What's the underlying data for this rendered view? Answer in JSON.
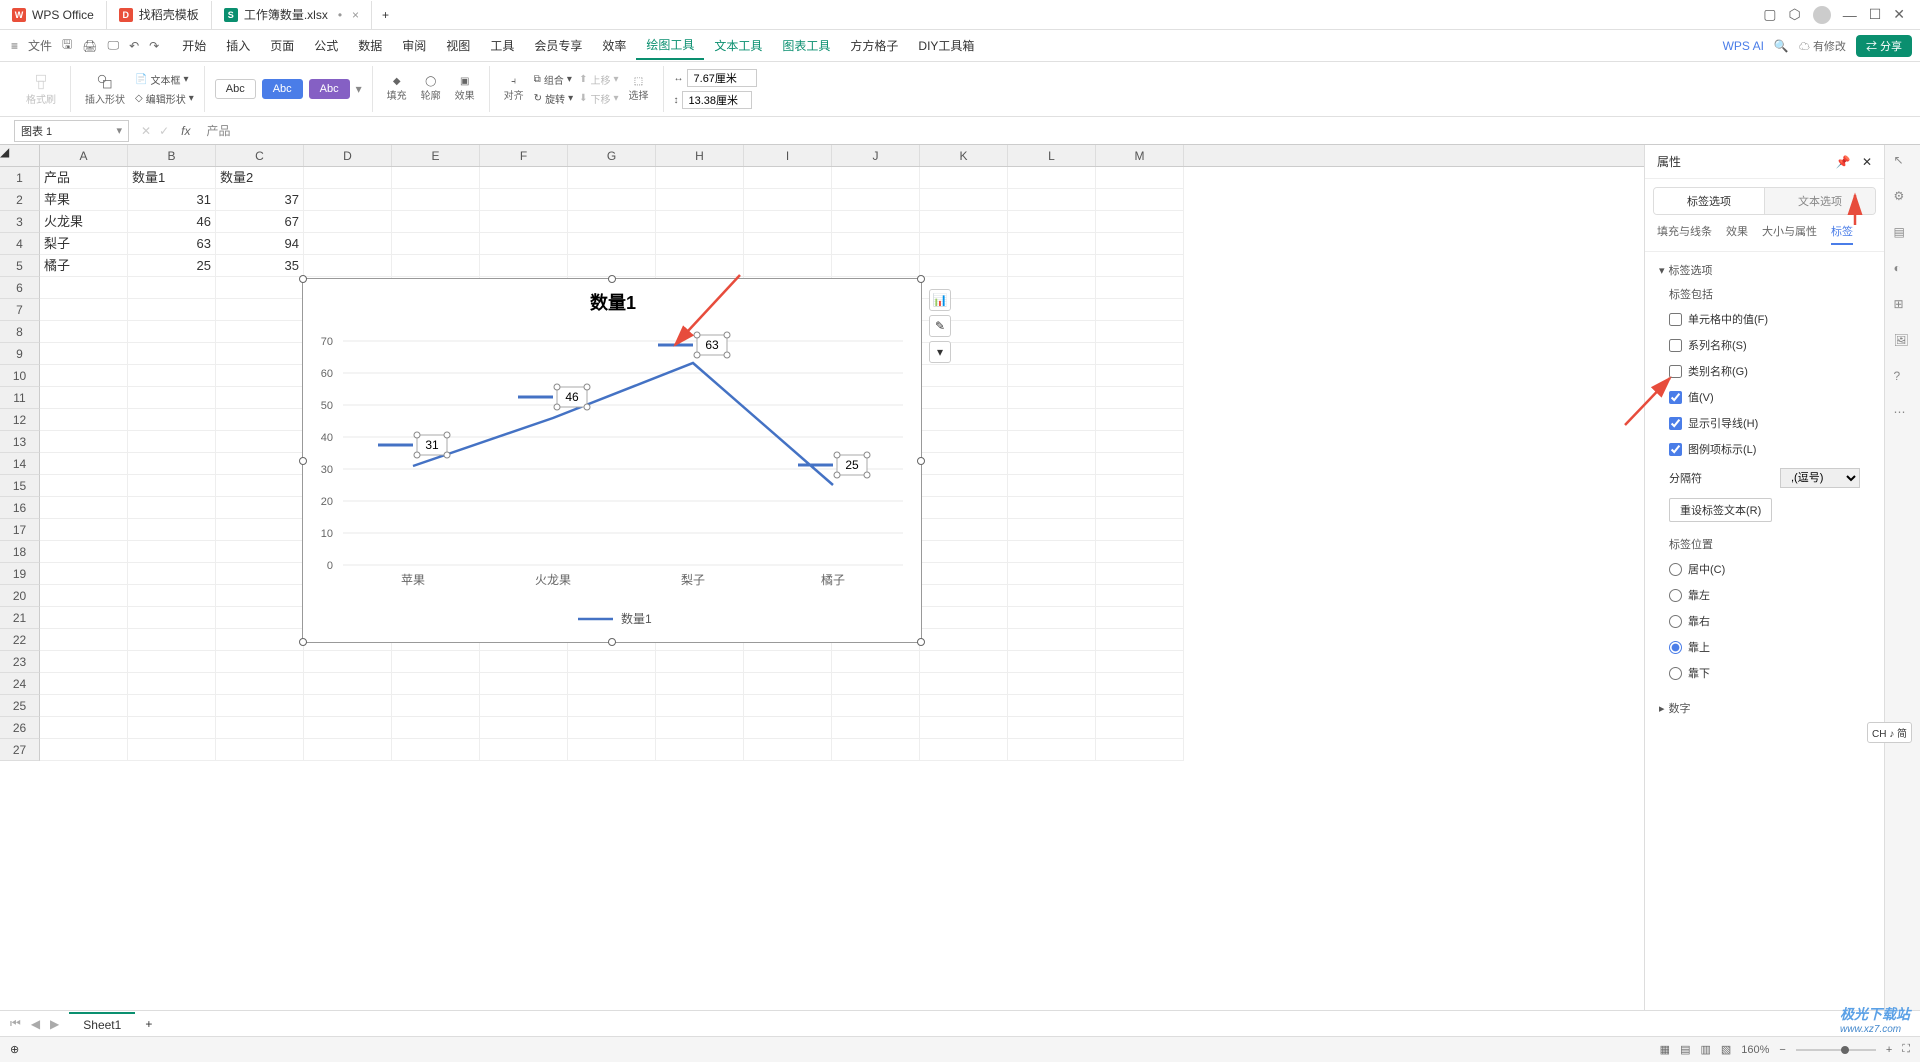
{
  "app": {
    "name": "WPS Office"
  },
  "tabs": [
    {
      "label": "找稻壳模板",
      "icon": "D"
    },
    {
      "label": "工作簿数量.xlsx",
      "icon": "S",
      "active": true
    }
  ],
  "menus": {
    "file": "文件",
    "items": [
      "开始",
      "插入",
      "页面",
      "公式",
      "数据",
      "审阅",
      "视图",
      "工具",
      "会员专享",
      "效率",
      "绘图工具",
      "文本工具",
      "图表工具",
      "方方格子",
      "DIY工具箱"
    ],
    "activeIndex": 10,
    "ai": "WPS AI",
    "modify": "有修改",
    "share": "分享"
  },
  "toolbar": {
    "format_brush": "格式刷",
    "insert_shape": "插入形状",
    "text_box": "文本框",
    "edit_shape": "编辑形状",
    "abc": "Abc",
    "fill": "填充",
    "outline": "轮廓",
    "effect": "效果",
    "align": "对齐",
    "group": "组合",
    "rotate": "旋转",
    "up": "上移",
    "down": "下移",
    "select": "选择",
    "width": "7.67厘米",
    "height": "13.38厘米"
  },
  "formula": {
    "name_box": "图表 1",
    "content": "产品"
  },
  "sheet": {
    "columns": [
      "A",
      "B",
      "C",
      "D",
      "E",
      "F",
      "G",
      "H",
      "I",
      "J",
      "K",
      "L",
      "M"
    ],
    "rows_visible": 27,
    "data": [
      [
        "产品",
        "数量1",
        "数量2"
      ],
      [
        "苹果",
        "31",
        "37"
      ],
      [
        "火龙果",
        "46",
        "67"
      ],
      [
        "梨子",
        "63",
        "94"
      ],
      [
        "橘子",
        "25",
        "35"
      ]
    ]
  },
  "chart_data": {
    "type": "line",
    "title": "数量1",
    "categories": [
      "苹果",
      "火龙果",
      "梨子",
      "橘子"
    ],
    "series": [
      {
        "name": "数量1",
        "values": [
          31,
          46,
          63,
          25
        ]
      }
    ],
    "data_labels": [
      31,
      46,
      63,
      25
    ],
    "ylim": [
      0,
      70
    ],
    "yticks": [
      0,
      10,
      20,
      30,
      40,
      50,
      60,
      70
    ],
    "legend": "数量1",
    "legend_position": "bottom"
  },
  "properties": {
    "header": "属性",
    "main_tabs": [
      "标签选项",
      "文本选项"
    ],
    "sub_tabs": [
      "填充与线条",
      "效果",
      "大小与属性",
      "标签"
    ],
    "sub_active": 3,
    "label_options_title": "标签选项",
    "label_include": "标签包括",
    "checks": {
      "cell_value": "单元格中的值(F)",
      "series_name": "系列名称(S)",
      "category_name": "类别名称(G)",
      "value": "值(V)",
      "leader_line": "显示引导线(H)",
      "legend_key": "图例项标示(L)"
    },
    "separator": "分隔符",
    "separator_value": ",(逗号)",
    "reset": "重设标签文本(R)",
    "position_title": "标签位置",
    "positions": {
      "center": "居中(C)",
      "left": "靠左",
      "right": "靠右",
      "top": "靠上",
      "bottom": "靠下"
    },
    "number_title": "数字"
  },
  "sheet_tab": "Sheet1",
  "status": {
    "zoom": "160%",
    "ime": "CH ♪ 简"
  },
  "watermark": {
    "l1": "极光下载站",
    "l2": "www.xz7.com"
  }
}
